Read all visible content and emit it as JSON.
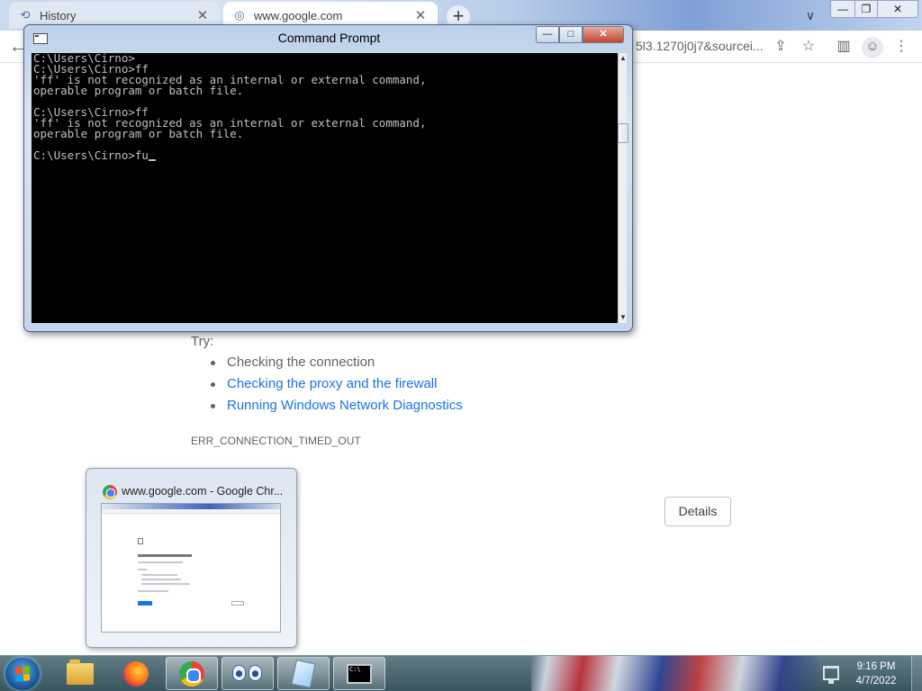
{
  "browser": {
    "tabs": [
      {
        "label": "History",
        "icon": "history-icon"
      },
      {
        "label": "www.google.com",
        "icon": "globe-icon"
      }
    ],
    "new_tab_label": "+",
    "url_tail": "5l3.1270j0j7&sourcei..."
  },
  "error_page": {
    "try_label": "Try:",
    "suggestions": [
      {
        "text": "Checking the connection",
        "link": false
      },
      {
        "text": "Checking the proxy and the firewall",
        "link": true
      },
      {
        "text": "Running Windows Network Diagnostics",
        "link": true
      }
    ],
    "error_code": "ERR_CONNECTION_TIMED_OUT",
    "details_button": "Details",
    "link_color": "#1a73e8"
  },
  "cmd_window": {
    "title": "Command Prompt",
    "lines": [
      "C:\\Users\\Cirno>",
      "C:\\Users\\Cirno>ff",
      "'ff' is not recognized as an internal or external command,",
      "operable program or batch file.",
      "",
      "C:\\Users\\Cirno>ff",
      "'ff' is not recognized as an internal or external command,",
      "operable program or batch file.",
      "",
      "C:\\Users\\Cirno>fu"
    ],
    "console_bg": "#000000",
    "console_fg": "#c0c0c0"
  },
  "taskbar_preview": {
    "title": "www.google.com - Google Chr..."
  },
  "taskbar": {
    "items": [
      "explorer-icon",
      "firefox-icon",
      "chrome-icon",
      "image-viewer-icon",
      "notepad-icon",
      "command-prompt-icon"
    ],
    "active_item": "chrome-icon",
    "clock_time": "9:16 PM",
    "clock_date": "4/7/2022"
  }
}
